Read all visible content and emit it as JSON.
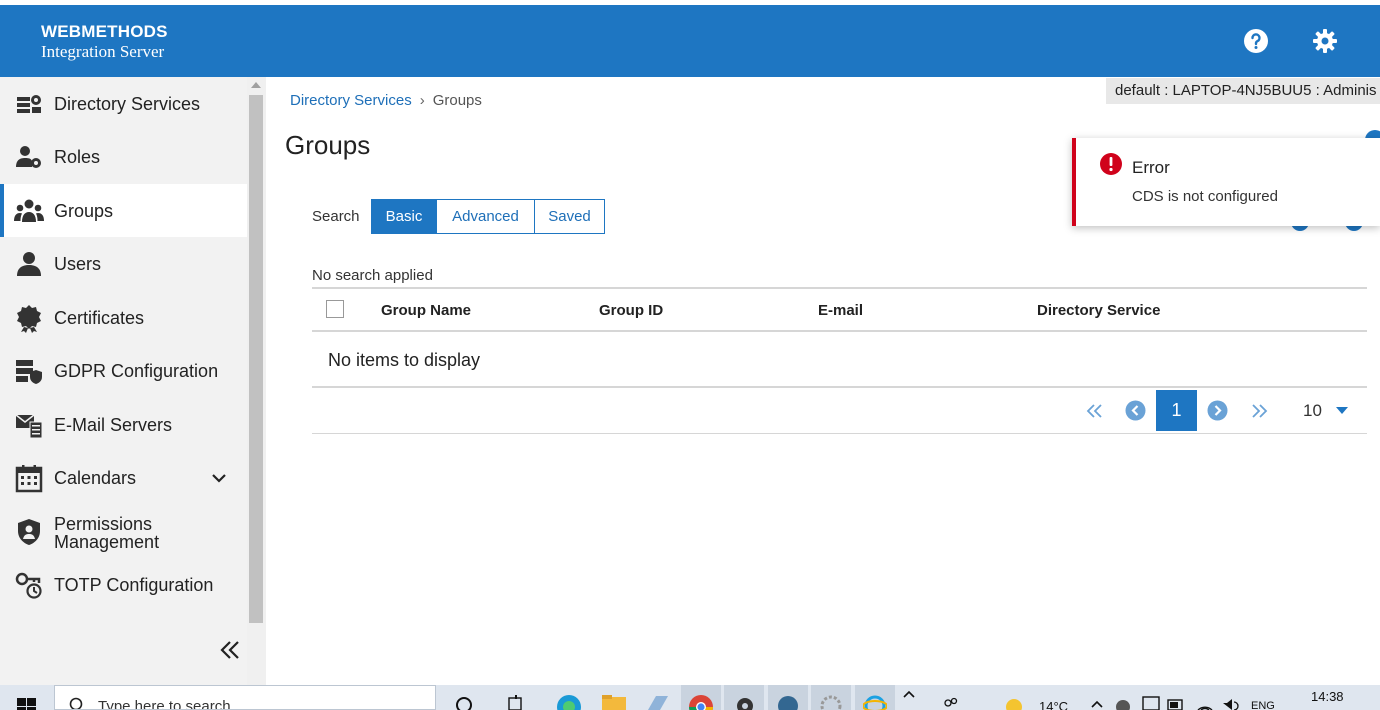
{
  "header": {
    "brand_line1": "WEBMETHODS",
    "brand_line2": "Integration Server",
    "help_icon": "help-circle-icon",
    "settings_icon": "gear-icon"
  },
  "colors": {
    "brand_blue": "#1e76c2",
    "error_red": "#d0021b",
    "sidebar_bg": "#f2f2f2"
  },
  "sidebar": {
    "items": [
      {
        "label": "Directory Services",
        "icon": "directory-services-icon"
      },
      {
        "label": "Roles",
        "icon": "roles-icon"
      },
      {
        "label": "Groups",
        "icon": "groups-icon",
        "active": true
      },
      {
        "label": "Users",
        "icon": "user-icon"
      },
      {
        "label": "Certificates",
        "icon": "certificate-icon"
      },
      {
        "label": "GDPR Configuration",
        "icon": "gdpr-icon"
      },
      {
        "label": "E-Mail Servers",
        "icon": "email-server-icon"
      },
      {
        "label": "Calendars",
        "icon": "calendar-icon",
        "expandable": true
      },
      {
        "label_line1": "Permissions",
        "label_line2": "Management",
        "icon": "permissions-shield-icon"
      },
      {
        "label": "TOTP Configuration",
        "icon": "totp-key-icon"
      }
    ],
    "collapse_icon": "double-chevron-left-icon"
  },
  "breadcrumb": {
    "parent": "Directory Services",
    "current": "Groups"
  },
  "page": {
    "title": "Groups",
    "server_info": "default : LAPTOP-4NJ5BUU5 : Adminis"
  },
  "search": {
    "label": "Search",
    "tabs": [
      "Basic",
      "Advanced",
      "Saved"
    ],
    "active_tab": "Basic",
    "status": "No search applied"
  },
  "table": {
    "columns": [
      "Group Name",
      "Group ID",
      "E-mail",
      "Directory Service"
    ],
    "empty_message": "No items to display"
  },
  "pagination": {
    "current_page": "1",
    "page_size": "10"
  },
  "toast": {
    "title": "Error",
    "message": "CDS is not configured"
  },
  "taskbar": {
    "search_placeholder": "Type here to search",
    "weather": "14°C",
    "language": "ENG",
    "time": "14:38"
  }
}
